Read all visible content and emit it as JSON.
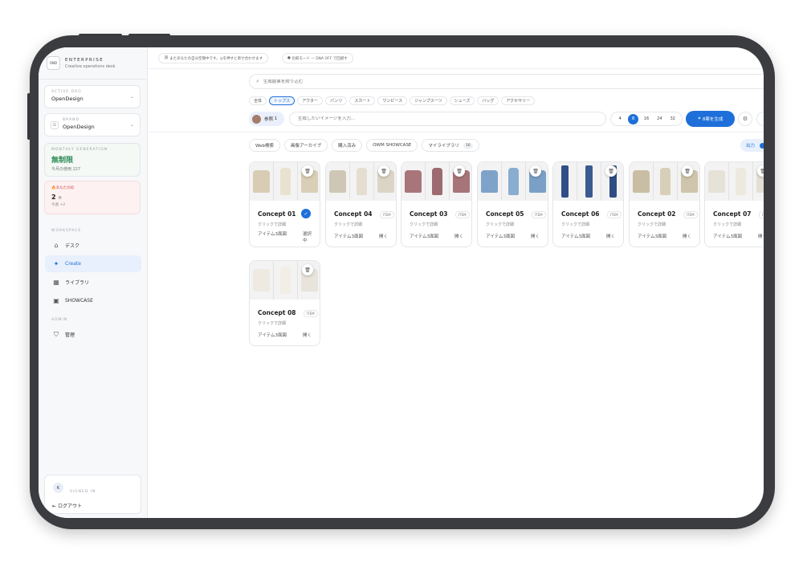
{
  "sidebar": {
    "brand": {
      "logo": "OND",
      "name": "ENTERPRISE",
      "subtitle": "Creative operations desk"
    },
    "active_org": {
      "label": "ACTIVE ORG",
      "value": "OpenDesign"
    },
    "brand_select": {
      "label": "BRAND",
      "icon_letter": "O",
      "value": "OpenDesign"
    },
    "monthly": {
      "label": "MONTHLY GENERATION",
      "value": "無制限",
      "sub": "今月の使用 227"
    },
    "user_stats": {
      "label": "あなたの枠",
      "count": "2",
      "unit": "件",
      "sub": "今週 +2"
    },
    "workspace_label": "WORKSPACE",
    "nav": [
      {
        "label": "デスク",
        "icon": "home-icon"
      },
      {
        "label": "Create",
        "icon": "sparkle-icon"
      },
      {
        "label": "ライブラリ",
        "icon": "grid-icon"
      },
      {
        "label": "SHOWCASE",
        "icon": "box-icon"
      }
    ],
    "admin_label": "ADMIN",
    "admin_nav": [
      {
        "label": "管理",
        "icon": "shield-icon"
      }
    ],
    "signed": {
      "avatar": "K",
      "label": "SIGNED IN",
      "logout": "ログアウト"
    }
  },
  "topbar": {
    "chip1": "またあなたの自分空間中です。◎を押すと寄せ合わせます",
    "chip2": "比較モード — DNA OFF で回避す"
  },
  "search": {
    "placeholder": "生成結果を絞り込む"
  },
  "categories": [
    {
      "label": "全体",
      "active": false
    },
    {
      "label": "トップス",
      "active": true
    },
    {
      "label": "アウター",
      "active": false
    },
    {
      "label": "パンツ",
      "active": false
    },
    {
      "label": "スカート",
      "active": false
    },
    {
      "label": "ワンピース",
      "active": false
    },
    {
      "label": "ジャンプスーツ",
      "active": false
    },
    {
      "label": "シューズ",
      "active": false
    },
    {
      "label": "バッグ",
      "active": false
    },
    {
      "label": "アクセサリー",
      "active": false
    }
  ],
  "reference": {
    "label": "参照",
    "count": "1"
  },
  "prompt": {
    "placeholder": "生成したいイメージを入力..."
  },
  "counts": [
    "4",
    "8",
    "16",
    "24",
    "32"
  ],
  "selected_count": "8",
  "generate_label": "8案を生成",
  "filters": [
    {
      "label": "Web検索"
    },
    {
      "label": "画像アーカイブ"
    },
    {
      "label": "購入済み"
    },
    {
      "label": "OWM SHOWCASE"
    },
    {
      "label": "マイライブラリ",
      "badge": "16"
    }
  ],
  "output_label": "出力",
  "concepts": [
    {
      "title": "Concept 01",
      "sub": "クリックで詳細",
      "left_action": "アイテム3面図",
      "right_action": "選択中",
      "selected": true,
      "colors": [
        "#d8cdb4",
        "#e9e2d0",
        "#d9cfb6"
      ]
    },
    {
      "title": "Concept 04",
      "badge": "ITEM",
      "sub": "クリックで詳細",
      "left_action": "アイテム3面図",
      "right_action": "開く",
      "colors": [
        "#cfc7b6",
        "#e5ded0",
        "#dcd5c6"
      ]
    },
    {
      "title": "Concept 03",
      "badge": "ITEM",
      "sub": "クリックで詳細",
      "left_action": "アイテム3面図",
      "right_action": "開く",
      "colors": [
        "#a8767a",
        "#9d6b70",
        "#a77479"
      ]
    },
    {
      "title": "Concept 05",
      "badge": "ITEM",
      "sub": "クリックで詳細",
      "left_action": "アイテム3面図",
      "right_action": "開く",
      "colors": [
        "#7fa3c8",
        "#8aadd0",
        "#7aa0c6"
      ]
    },
    {
      "title": "Concept 06",
      "badge": "ITEM",
      "sub": "クリックで詳細",
      "left_action": "アイテム3面図",
      "right_action": "開く",
      "colors": [
        "#2f4f86",
        "#3a5a90",
        "#2e4d84"
      ]
    },
    {
      "title": "Concept 02",
      "badge": "ITEM",
      "sub": "クリックで詳細",
      "left_action": "アイテム3面図",
      "right_action": "開く",
      "colors": [
        "#c9bea4",
        "#d8cfb8",
        "#cfc5ac"
      ]
    },
    {
      "title": "Concept 07",
      "badge": "ITEM",
      "sub": "クリックで詳細",
      "left_action": "アイテム3面図",
      "right_action": "開く",
      "colors": [
        "#e6e2d8",
        "#ede9df",
        "#e3dfd4"
      ]
    },
    {
      "title": "Concept 08",
      "badge": "ITEM",
      "sub": "クリックで詳細",
      "left_action": "アイテム3面図",
      "right_action": "開く",
      "colors": [
        "#eeeae2",
        "#f2eee6",
        "#e8e4dc"
      ]
    }
  ]
}
